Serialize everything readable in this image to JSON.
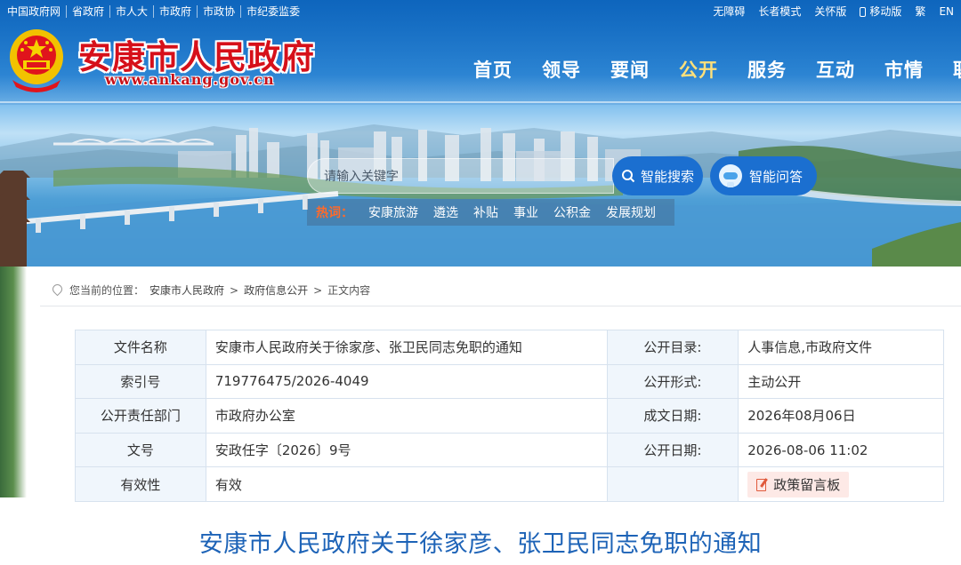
{
  "topbar": {
    "links": [
      "中国政府网",
      "省政府",
      "市人大",
      "市政府",
      "市政协",
      "市纪委监委"
    ],
    "right": {
      "accessibility": "无障碍",
      "elder_mode": "长者模式",
      "care_version": "关怀版",
      "mobile": "移动版",
      "traditional": "繁",
      "english": "EN"
    }
  },
  "logo": {
    "name": "安康市人民政府",
    "url": "www.ankang.gov.cn"
  },
  "nav": {
    "items": [
      "首页",
      "领导",
      "要闻",
      "公开",
      "服务",
      "互动",
      "市情",
      "联"
    ],
    "active": "公开"
  },
  "search": {
    "placeholder": "请输入关键字",
    "search_button": "智能搜索",
    "qa_button": "智能问答",
    "hot_label": "热词：",
    "hot_words": [
      "安康旅游",
      "遴选",
      "补贴",
      "事业",
      "公积金",
      "发展规划"
    ]
  },
  "breadcrumb": {
    "prefix": "您当前的位置：",
    "items": [
      "安康市人民政府",
      "政府信息公开",
      "正文内容"
    ],
    "separator": ">"
  },
  "meta_table": {
    "rows": [
      {
        "k1": "文件名称",
        "v1": "安康市人民政府关于徐家彦、张卫民同志免职的通知",
        "k2": "公开目录:",
        "v2": "人事信息,市政府文件"
      },
      {
        "k1": "索引号",
        "v1": "719776475/2026-4049",
        "k2": "公开形式:",
        "v2": "主动公开"
      },
      {
        "k1": "公开责任部门",
        "v1": "市政府办公室",
        "k2": "成文日期:",
        "v2": "2026年08月06日"
      },
      {
        "k1": "文号",
        "v1": "安政任字〔2026〕9号",
        "k2": "公开日期:",
        "v2": "2026-08-06 11:02"
      },
      {
        "k1": "有效性",
        "v1": "有效",
        "k2": "",
        "v2": "政策留言板"
      }
    ]
  },
  "document": {
    "title": "安康市人民政府关于徐家彦、张卫民同志免职的通知"
  },
  "colors": {
    "header_blue": "#1f7fd4",
    "brand_red": "#d6101a",
    "nav_active": "#ffe07a",
    "title_blue": "#1d63b7",
    "button_blue": "#1b6fd0",
    "hot_orange": "#ff6a2a"
  }
}
